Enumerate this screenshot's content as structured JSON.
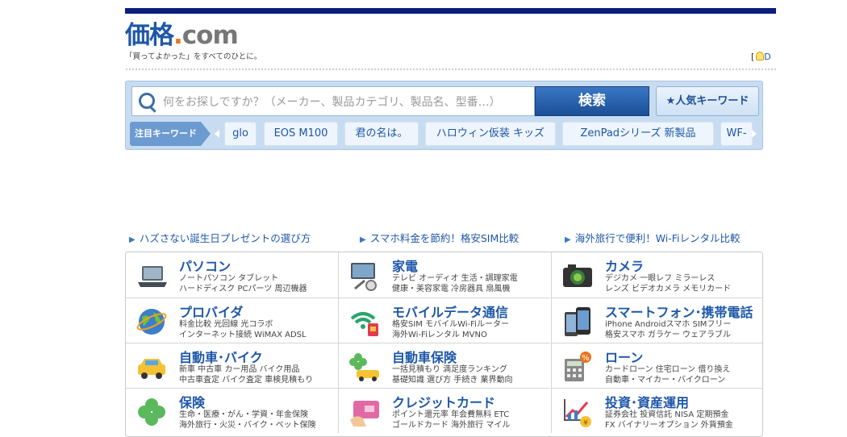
{
  "header": {
    "logo_kanji": "価格",
    "logo_dot": ".",
    "logo_com": "com",
    "tagline": "「買ってよかった」をすべてのひとに。",
    "corner_left": "[",
    "corner_right": "D"
  },
  "search": {
    "placeholder": "何をお探しですか？（メーカー、製品カテゴリ、製品名、型番…）",
    "button_label": "検索",
    "popular_keywords_label": "★人気キーワード",
    "featured_label": "注目キーワード",
    "keywords": [
      "glo",
      "EOS M100",
      "君の名は。",
      "ハロウィン仮装 キッズ",
      "ZenPadシリーズ 新製品",
      "WF-"
    ]
  },
  "promos": [
    "ハズさない誕生日プレゼントの選び方",
    "スマホ料金を節約！格安SIM比較",
    "海外旅行で便利！Wi-Fiレンタル比較"
  ],
  "categories": [
    {
      "title": "パソコン",
      "sub1": "ノートパソコン タブレット",
      "sub2": "ハードディスク PCパーツ 周辺機器",
      "icon": "laptop-icon"
    },
    {
      "title": "家電",
      "sub1": "テレビ オーディオ 生活・調理家電",
      "sub2": "健康・美容家電 冷房器具 扇風機",
      "icon": "tv-icon"
    },
    {
      "title": "カメラ",
      "sub1": "デジカメ 一眼レフ ミラーレス",
      "sub2": "レンズ ビデオカメラ メモリカード",
      "icon": "camera-icon"
    },
    {
      "title": "プロバイダ",
      "sub1": "料金比較 光回線 光コラボ",
      "sub2": "インターネット接続 WiMAX ADSL",
      "icon": "globe-icon"
    },
    {
      "title": "モバイルデータ通信",
      "sub1": "格安SIM モバイルWi-Fiルーター",
      "sub2": "海外Wi-Fiレンタル MVNO",
      "icon": "wifi-sim-icon"
    },
    {
      "title": "スマートフォン･携帯電話",
      "sub1": "iPhone Androidスマホ SIMフリー",
      "sub2": "格安スマホ ガラケー ウェアラブル",
      "icon": "smartphone-icon"
    },
    {
      "title": "自動車･バイク",
      "sub1": "新車 中古車 カー用品 バイク用品",
      "sub2": "中古車査定 バイク査定 車検見積もり",
      "icon": "car-icon"
    },
    {
      "title": "自動車保険",
      "sub1": "一括見積もり 満足度ランキング",
      "sub2": "基礎知識 選び方 手続き 業界動向",
      "icon": "clover-car-icon"
    },
    {
      "title": "ローン",
      "sub1": "カードローン 住宅ローン 借り換え",
      "sub2": "自動車・マイカー・バイクローン",
      "icon": "calculator-icon"
    },
    {
      "title": "保険",
      "sub1": "生命・医療・がん・学資・年金保険",
      "sub2": "海外旅行・火災・バイク・ペット保険",
      "icon": "clover-icon"
    },
    {
      "title": "クレジットカード",
      "sub1": "ポイント還元率 年会費無料 ETC",
      "sub2": "ゴールドカード 海外旅行 マイル",
      "icon": "credit-card-icon"
    },
    {
      "title": "投資･資産運用",
      "sub1": "証券会社 投資信託 NISA 定期預金",
      "sub2": "FX バイナリーオプション 外貨預金",
      "icon": "chart-coin-icon"
    }
  ],
  "colors": {
    "brand_blue": "#1e57a8",
    "nav_dark": "#0a1f7c",
    "accent_orange": "#e8731d"
  }
}
